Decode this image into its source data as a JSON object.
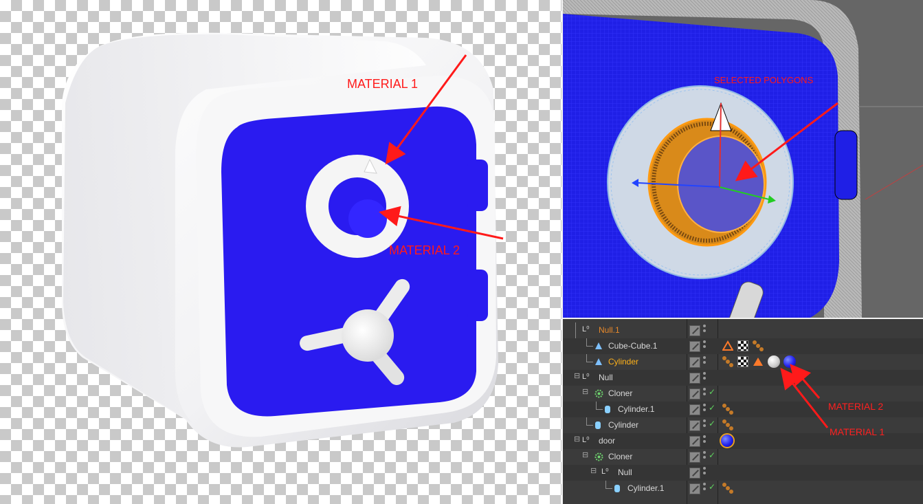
{
  "render_panel": {
    "annotations": {
      "material_1": "MATERIAL 1",
      "material_2": "MATERIAL 2"
    },
    "colors": {
      "body": "#f4f4f4",
      "door": "#2a1bf0",
      "annotation": "#ff1a1a"
    }
  },
  "viewport_panel": {
    "annotation": "SELECTED POLYGONS"
  },
  "object_manager": {
    "rows": [
      {
        "name": "Null.1",
        "icon": "null-icon",
        "state": "orange"
      },
      {
        "name": "Cube-Cube.1",
        "icon": "polygon-object-icon",
        "tags": [
          "material-cone-tag-icon",
          "checker-texture-tag-icon",
          "phong-tag-icon"
        ]
      },
      {
        "name": "Cylinder",
        "icon": "polygon-object-icon",
        "state": "active",
        "tags": [
          "phong-tag-icon",
          "checker-texture-tag-icon",
          "material-cone-tag-icon",
          "material-white-ball-icon",
          "material-blue-ball-icon"
        ]
      },
      {
        "name": "Null",
        "icon": "null-icon"
      },
      {
        "name": "Cloner",
        "icon": "cloner-icon",
        "checked": true
      },
      {
        "name": "Cylinder.1",
        "icon": "cylinder-icon",
        "checked": true,
        "tags": [
          "phong-tag-icon"
        ]
      },
      {
        "name": "Cylinder",
        "icon": "cylinder-icon",
        "checked": true,
        "tags": [
          "phong-tag-icon"
        ]
      },
      {
        "name": "door",
        "icon": "null-icon",
        "tags": [
          "material-blue-ball-icon"
        ]
      },
      {
        "name": "Cloner",
        "icon": "cloner-icon",
        "checked": true
      },
      {
        "name": "Null",
        "icon": "null-icon"
      },
      {
        "name": "Cylinder.1",
        "icon": "cylinder-icon",
        "checked": true,
        "tags": [
          "phong-tag-icon"
        ]
      }
    ],
    "annotations": {
      "material_2": "MATERIAL 2",
      "material_1": "MATERIAL 1"
    }
  }
}
